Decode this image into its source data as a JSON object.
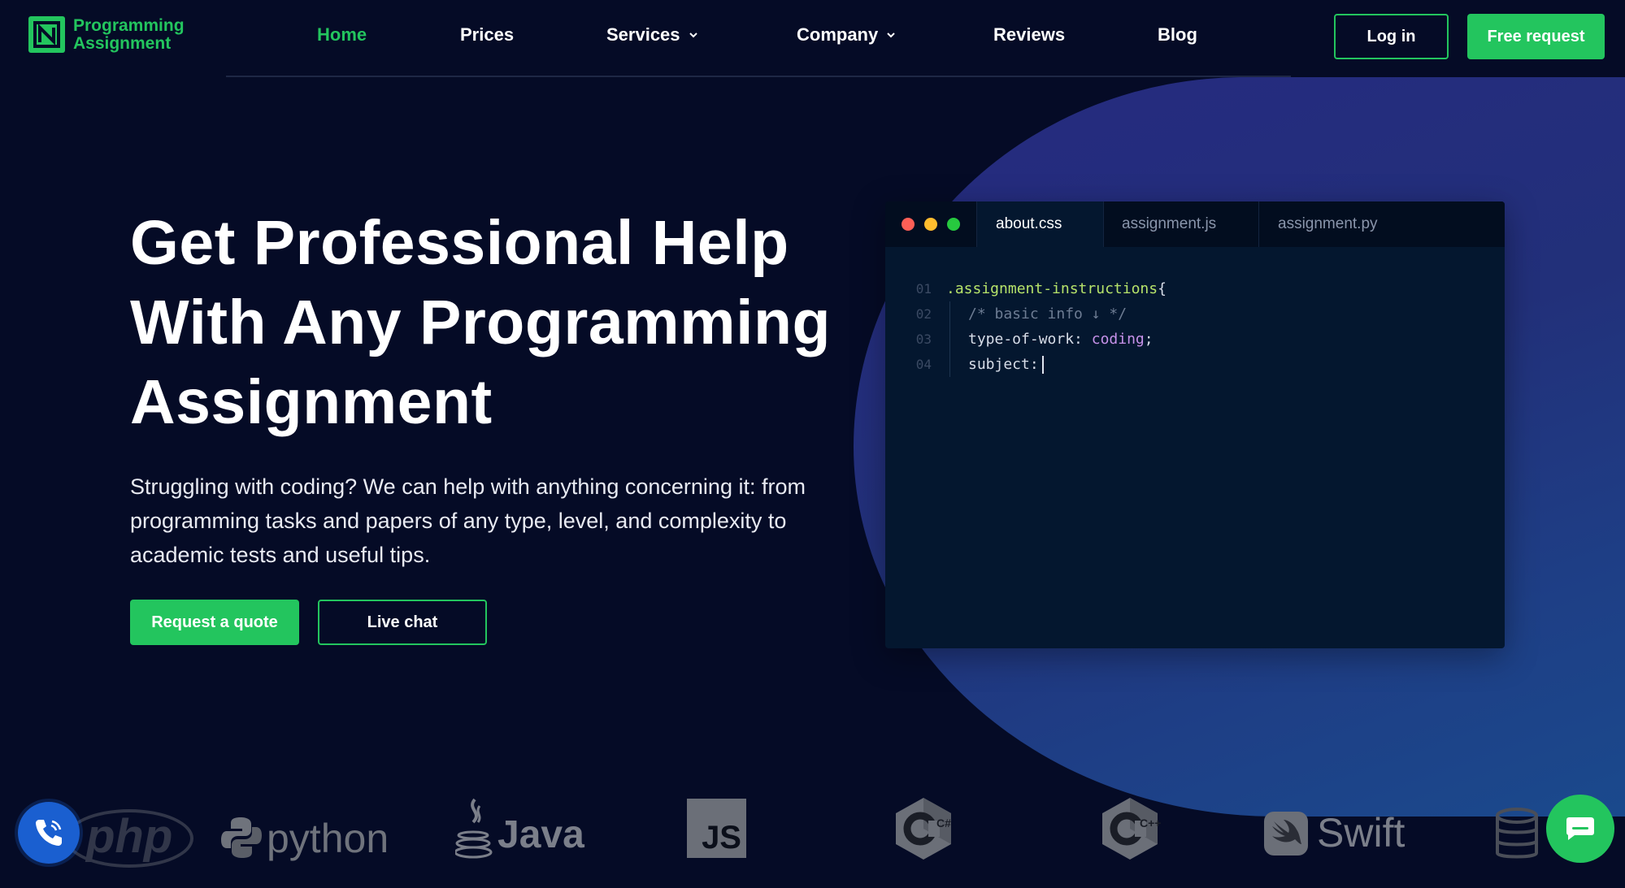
{
  "brand": {
    "name_line1": "Programming",
    "name_line2": "Assignment",
    "color": "#23c55e"
  },
  "nav": {
    "links": [
      {
        "label": "Home",
        "active": true
      },
      {
        "label": "Prices"
      },
      {
        "label": "Services",
        "dropdown": true
      },
      {
        "label": "Company",
        "dropdown": true
      },
      {
        "label": "Reviews"
      },
      {
        "label": "Blog"
      }
    ],
    "login_label": "Log in",
    "free_request_label": "Free request"
  },
  "hero": {
    "title_line1": "Get Professional Help",
    "title_line2": "With Any Programming",
    "title_line3": "Assignment",
    "subtitle": "Struggling with coding? We can help with anything concerning it: from programming tasks and papers of any type, level, and complexity to academic tests and useful tips.",
    "request_quote_label": "Request a quote",
    "live_chat_label": "Live chat"
  },
  "code_window": {
    "tabs": [
      "about.css",
      "assignment.js",
      "assignment.py"
    ],
    "active_tab": "about.css",
    "lines": [
      {
        "num": "01",
        "selector": ".assignment-instructions",
        "brace": "{"
      },
      {
        "num": "02",
        "comment": "/* basic info ↓ */"
      },
      {
        "num": "03",
        "prop": "type-of-work:",
        "value": "coding",
        "end": ";"
      },
      {
        "num": "04",
        "prop": "subject:"
      }
    ]
  },
  "technologies": [
    "php",
    "python",
    "Java",
    "JS",
    "C#",
    "C++",
    "Swift"
  ],
  "colors": {
    "accent": "#23c55e",
    "background": "#050b26",
    "call_button": "#1a5fd0"
  },
  "icons": {
    "call": "phone-icon",
    "chat": "chat-bubble-icon"
  }
}
